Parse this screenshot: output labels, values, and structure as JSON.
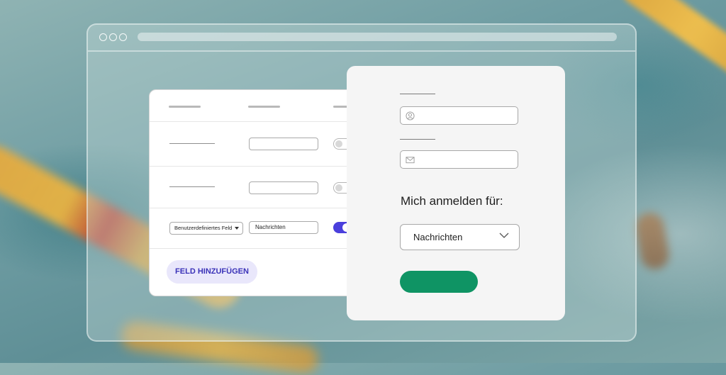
{
  "form_builder": {
    "custom_field_select": "Benutzerdefiniertes Feld",
    "custom_field_value": "Nachrichten",
    "add_field_label": "FELD HINZUFÜGEN",
    "toggles": [
      false,
      false,
      true
    ]
  },
  "signup_form": {
    "subscribe_heading": "Mich anmelden für:",
    "subscribe_selected": "Nachrichten",
    "submit_color": "#0f9464"
  },
  "colors": {
    "accent": "#4a3fdc",
    "add_button_bg": "#e9e7fb",
    "submit": "#0f9464"
  },
  "icons": [
    "user-icon",
    "mail-icon",
    "chevron-down-icon"
  ]
}
